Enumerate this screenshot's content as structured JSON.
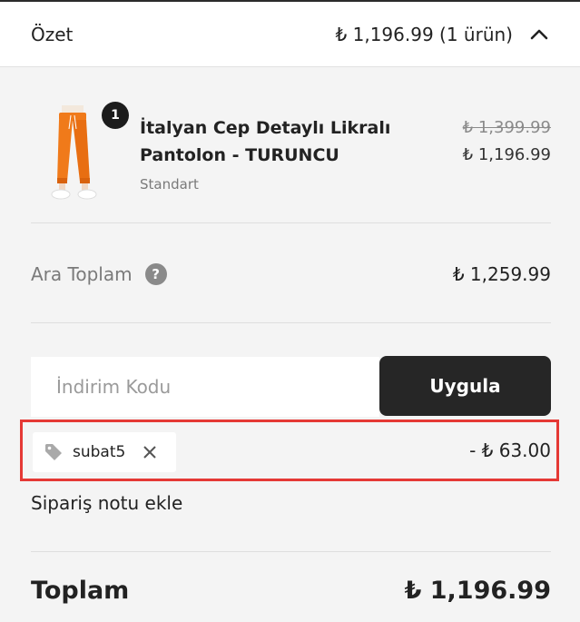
{
  "header": {
    "title": "Özet",
    "total": "₺ 1,196.99 (1 ürün)",
    "toggle_icon": "chevron-up-icon"
  },
  "product": {
    "quantity": "1",
    "name": "İtalyan Cep Detaylı Likralı Pantolon - TURUNCU",
    "variant": "Standart",
    "price_old": "₺ 1,399.99",
    "price_new": "₺ 1,196.99",
    "thumb_color": "#f07a1a"
  },
  "subtotal": {
    "label": "Ara Toplam",
    "help_icon": "?",
    "value": "₺ 1,259.99"
  },
  "discount": {
    "placeholder": "İndirim Kodu",
    "apply_label": "Uygula",
    "applied_code": "subat5",
    "amount": "- ₺ 63.00",
    "highlight_color": "#e53935"
  },
  "note": {
    "label": "Sipariş notu ekle"
  },
  "total": {
    "label": "Toplam",
    "value": "₺ 1,196.99"
  }
}
